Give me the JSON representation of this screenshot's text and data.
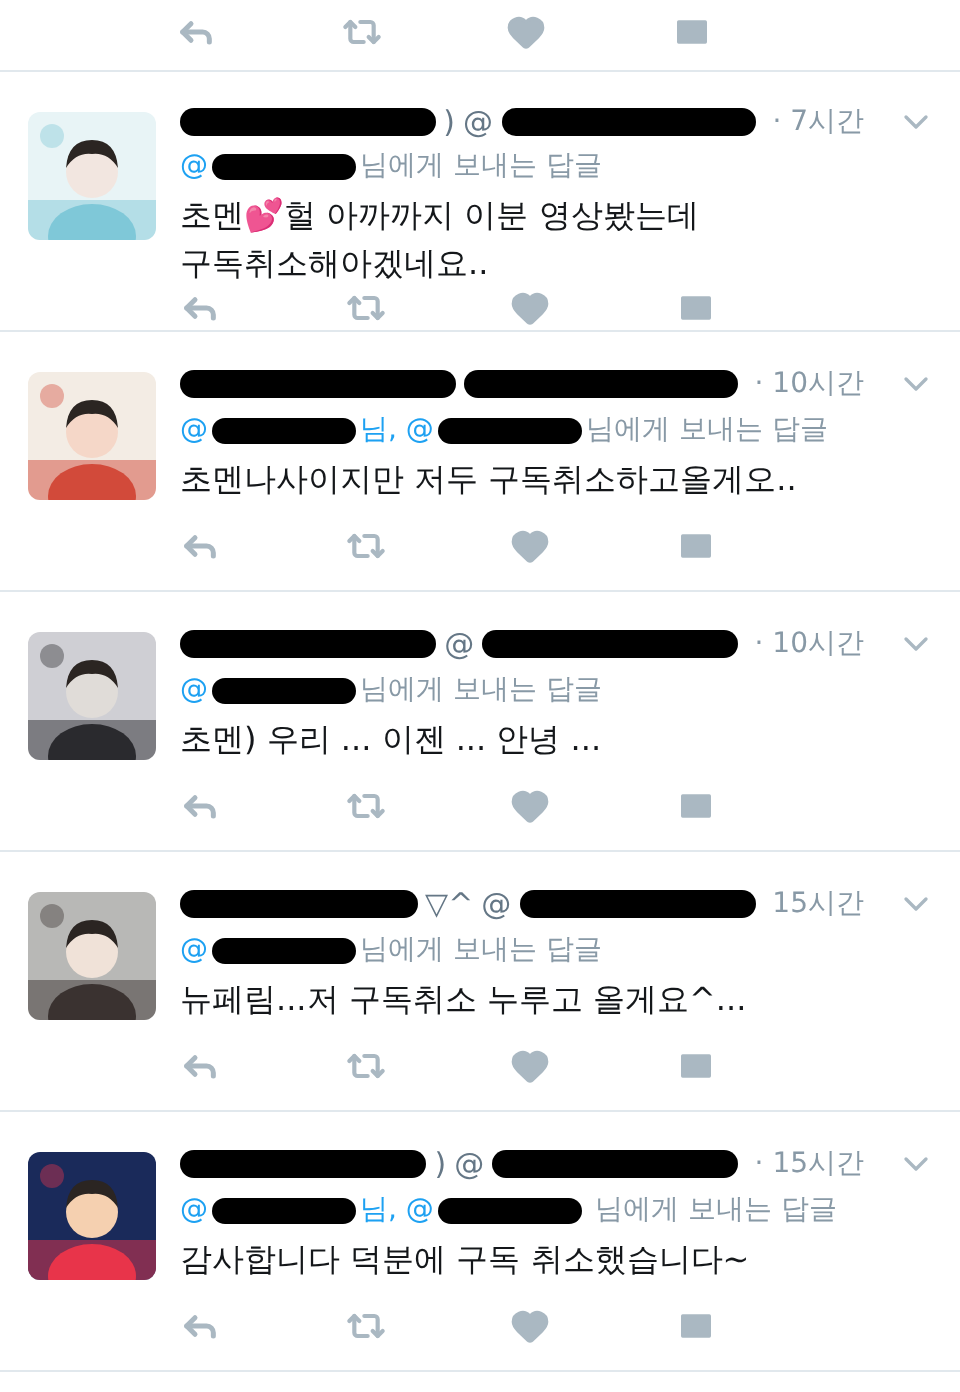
{
  "tweets": [
    {
      "header": [
        {
          "kind": "redacted"
        },
        {
          "kind": "text",
          "text": ")"
        },
        {
          "kind": "text",
          "text": "@"
        },
        {
          "kind": "redacted"
        }
      ],
      "time": "· 7시간",
      "reply": [
        {
          "kind": "mention",
          "text": "@"
        },
        {
          "kind": "redacted"
        },
        {
          "kind": "text",
          "text": "님에게 보내는 답글"
        }
      ],
      "lines": [
        "초멘💕헐 아까까지 이분 영상봤는데",
        "구독취소해아겠네요.."
      ]
    },
    {
      "header": [
        {
          "kind": "redacted"
        },
        {
          "kind": "redacted"
        }
      ],
      "time": "· 10시간",
      "reply": [
        {
          "kind": "mention",
          "text": "@"
        },
        {
          "kind": "redacted"
        },
        {
          "kind": "mention",
          "text": "님, @"
        },
        {
          "kind": "redacted"
        },
        {
          "kind": "text",
          "text": "님에게 보내는 답글"
        }
      ],
      "lines": [
        "초멘나사이지만 저두 구독취소하고올게오.."
      ]
    },
    {
      "header": [
        {
          "kind": "redacted"
        },
        {
          "kind": "text",
          "text": "@"
        },
        {
          "kind": "redacted"
        }
      ],
      "time": "· 10시간",
      "reply": [
        {
          "kind": "mention",
          "text": "@"
        },
        {
          "kind": "redacted"
        },
        {
          "kind": "text",
          "text": "님에게 보내는 답글"
        }
      ],
      "lines": [
        "초멘) 우리 ... 이젠 ... 안녕 ..."
      ]
    },
    {
      "header": [
        {
          "kind": "redacted"
        },
        {
          "kind": "text",
          "text": "▽^"
        },
        {
          "kind": "text",
          "text": "@"
        },
        {
          "kind": "redacted"
        }
      ],
      "time": "15시간",
      "reply": [
        {
          "kind": "mention",
          "text": "@"
        },
        {
          "kind": "redacted"
        },
        {
          "kind": "text",
          "text": "님에게 보내는 답글"
        }
      ],
      "lines": [
        "뉴페림...저 구독취소 누루고 올게요^..."
      ]
    },
    {
      "header": [
        {
          "kind": "redacted"
        },
        {
          "kind": "text",
          "text": ")"
        },
        {
          "kind": "text",
          "text": "@"
        },
        {
          "kind": "redacted"
        }
      ],
      "time": "· 15시간",
      "reply": [
        {
          "kind": "mention",
          "text": "@"
        },
        {
          "kind": "redacted"
        },
        {
          "kind": "mention",
          "text": "님, @"
        },
        {
          "kind": "redacted"
        },
        {
          "kind": "text",
          "text": " 님에게 보내는 답글"
        }
      ],
      "lines": [
        "감사합니다 덕분에 구독 취소했습니다~"
      ]
    }
  ]
}
